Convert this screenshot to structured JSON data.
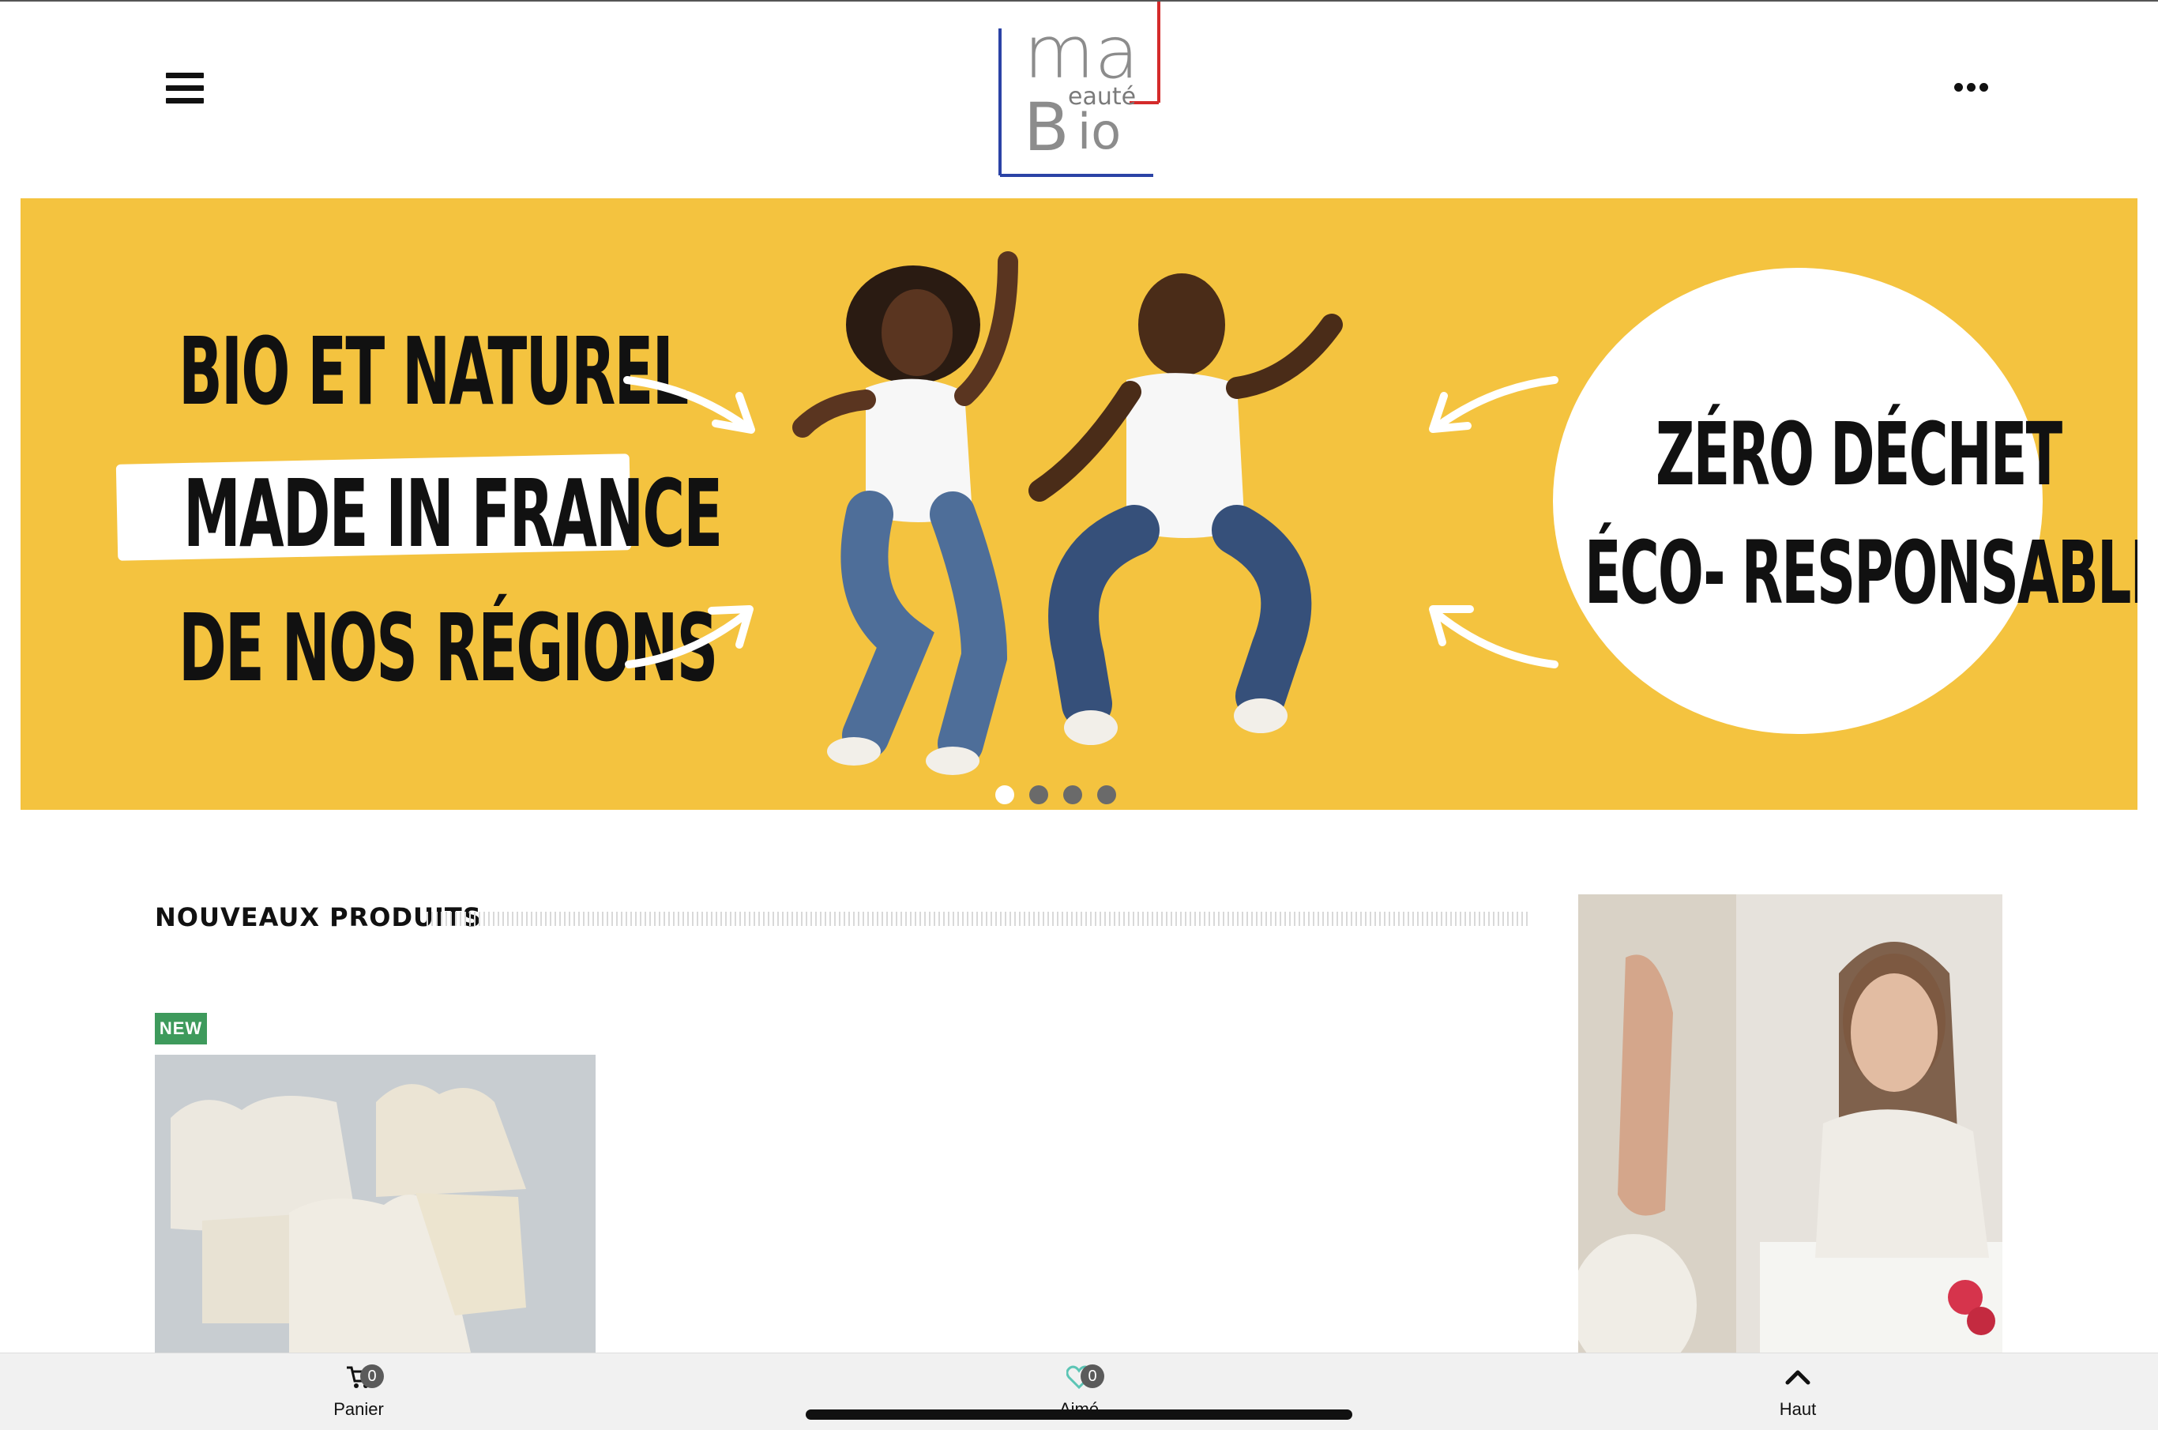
{
  "header": {
    "menu_icon": "hamburger-menu-icon",
    "more_icon": "ellipsis-icon",
    "logo": {
      "line1": "ma",
      "line2": "eauté",
      "line3": "B",
      "line4": "io"
    }
  },
  "hero": {
    "left_lines": [
      "BIO ET NATUREL",
      "MADE IN FRANCE",
      "DE NOS RÉGIONS"
    ],
    "right_lines": [
      "ZÉRO DÉCHET",
      "ÉCO- RESPONSABLE"
    ],
    "background_color": "#f4c33f",
    "slides": 4,
    "active_slide": 1
  },
  "section": {
    "title": "NOUVEAUX PRODUITS"
  },
  "product": {
    "badge": "NEW"
  },
  "bottom_bar": {
    "cart": {
      "label": "Panier",
      "count": "0",
      "icon": "cart-icon"
    },
    "liked": {
      "label": "Aimé",
      "count": "0",
      "icon": "heart-icon"
    },
    "top": {
      "label": "Haut",
      "icon": "chevron-up-icon"
    }
  }
}
